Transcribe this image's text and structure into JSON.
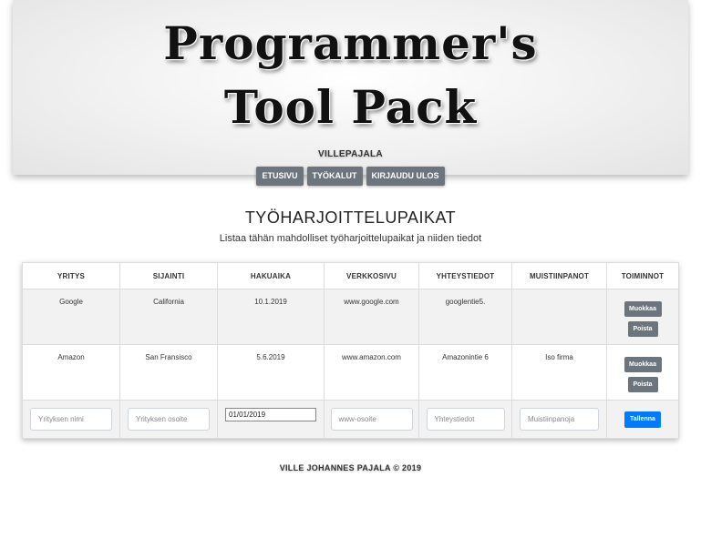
{
  "header": {
    "logo_line1": "Programmer's",
    "logo_line2": "Tool Pack",
    "username": "VILLEPAJALA",
    "nav": [
      "ETUSIVU",
      "TYÖKALUT",
      "KIRJAUDU ULOS"
    ]
  },
  "main": {
    "title": "TYÖHARJOITTELUPAIKAT",
    "subtitle": "Listaa tähän mahdolliset työharjoittelupaikat ja niiden tiedot"
  },
  "table": {
    "columns": [
      "YRITYS",
      "SIJAINTI",
      "HAKUAIKA",
      "VERKKOSIVU",
      "YHTEYSTIEDOT",
      "MUISTIINPANOT",
      "TOIMINNOT"
    ],
    "rows": [
      [
        "Google",
        "California",
        "10.1.2019",
        "www.google.com",
        "googlentie5.",
        ""
      ],
      [
        "Amazon",
        "San Fransisco",
        "5.6.2019",
        "www.amazon.com",
        "Amazonintie 6",
        "Iso firma"
      ]
    ],
    "edit_label": "Muokkaa",
    "delete_label": "Poista",
    "inputs": {
      "company_placeholder": "Yrityksen nimi",
      "location_placeholder": "Yrityksen osoite",
      "date_value": "01/01/2019",
      "website_placeholder": "www-osoite",
      "contact_placeholder": "Yhteystiedot",
      "notes_placeholder": "Muistiinpanoja"
    },
    "save_label": "Tallenna"
  },
  "footer": {
    "text": "VILLE JOHANNES PAJALA © 2019"
  },
  "colors": {
    "nav_button": "#6c757d",
    "primary_button": "#007bff",
    "row_shade": "#f2f2f2"
  }
}
